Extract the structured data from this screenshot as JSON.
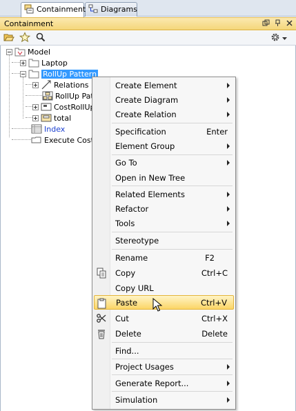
{
  "tabs": [
    {
      "label": "Containment",
      "active": true,
      "icon": "containment-icon"
    },
    {
      "label": "Diagrams",
      "active": false,
      "icon": "diagrams-icon"
    }
  ],
  "panel": {
    "title": "Containment"
  },
  "tree": {
    "nodes": [
      {
        "label": "Model",
        "icon": "model-package-icon",
        "expander": "minus"
      },
      {
        "label": "Laptop",
        "icon": "package-icon",
        "expander": "plus"
      },
      {
        "label": "RollUp Pattern",
        "icon": "package-icon",
        "expander": "minus",
        "selected": true
      },
      {
        "label": "Relations",
        "icon": "relations-icon",
        "expander": "plus"
      },
      {
        "label": "RollUp Patt",
        "icon": "diagram-icon",
        "expander": "none"
      },
      {
        "label": "CostRollUp",
        "icon": "block-icon",
        "expander": "plus"
      },
      {
        "label": "total",
        "icon": "block-icon",
        "expander": "plus"
      },
      {
        "label": "Index",
        "icon": "table-icon",
        "expander": "none",
        "color": "#1a3fd1"
      },
      {
        "label": "Execute Cost A",
        "icon": "flow-icon",
        "expander": "none"
      }
    ]
  },
  "context_menu": {
    "items": [
      {
        "label": "Create Element",
        "submenu": true
      },
      {
        "label": "Create Diagram",
        "submenu": true
      },
      {
        "label": "Create Relation",
        "submenu": true
      },
      {
        "separator": true
      },
      {
        "label": "Specification",
        "shortcut": "Enter"
      },
      {
        "label": "Element Group",
        "submenu": true
      },
      {
        "separator": true
      },
      {
        "label": "Go To",
        "submenu": true
      },
      {
        "label": "Open in New Tree"
      },
      {
        "separator": true
      },
      {
        "label": "Related Elements",
        "submenu": true
      },
      {
        "label": "Refactor",
        "submenu": true
      },
      {
        "label": "Tools",
        "submenu": true
      },
      {
        "separator": true
      },
      {
        "label": "Stereotype"
      },
      {
        "separator": true
      },
      {
        "label": "Rename",
        "shortcut": "F2"
      },
      {
        "label": "Copy",
        "shortcut": "Ctrl+C",
        "icon": "copy-icon"
      },
      {
        "label": "Copy URL"
      },
      {
        "label": "Paste",
        "shortcut": "Ctrl+V",
        "icon": "paste-icon",
        "hovered": true
      },
      {
        "label": "Cut",
        "shortcut": "Ctrl+X",
        "icon": "cut-icon"
      },
      {
        "label": "Delete",
        "shortcut": "Delete",
        "icon": "delete-icon"
      },
      {
        "separator": true
      },
      {
        "label": "Find..."
      },
      {
        "separator": true
      },
      {
        "label": "Project Usages",
        "submenu": true
      },
      {
        "separator": true
      },
      {
        "label": "Generate Report...",
        "submenu": true
      },
      {
        "separator": true
      },
      {
        "label": "Simulation",
        "submenu": true
      }
    ]
  },
  "colors": {
    "selection": "#3399ff",
    "hover_highlight": "#fbd566",
    "panel_header": "#f4d67a"
  }
}
